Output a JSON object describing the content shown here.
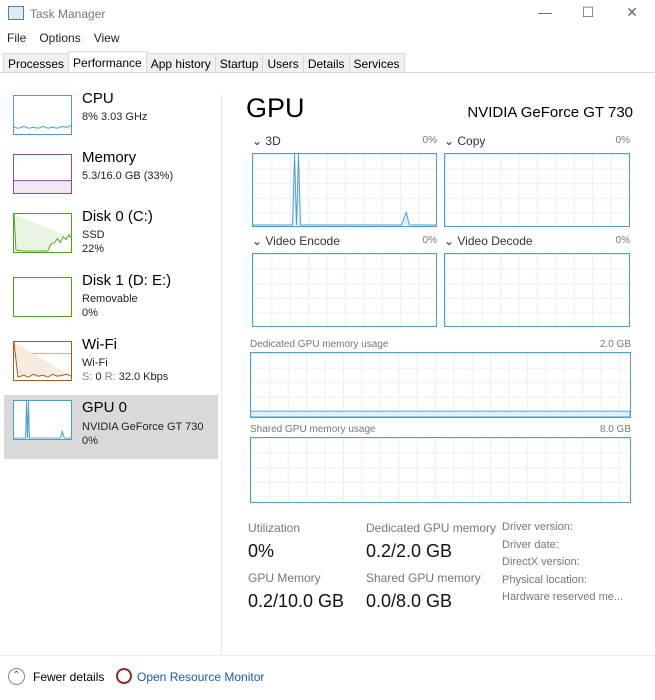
{
  "window": {
    "title": "Task Manager",
    "minimize": "—",
    "maximize": "☐",
    "close": "✕"
  },
  "menu": [
    "File",
    "Options",
    "View"
  ],
  "tabs": [
    "Processes",
    "Performance",
    "App history",
    "Startup",
    "Users",
    "Details",
    "Services"
  ],
  "sidebar": [
    {
      "name": "CPU",
      "line1": "8% 3.03 GHz",
      "line2": "",
      "color": "#4d9ecb"
    },
    {
      "name": "Memory",
      "line1": "5.3/16.0 GB (33%)",
      "line2": "",
      "color": "#8b4d9b"
    },
    {
      "name": "Disk 0 (C:)",
      "line1": "SSD",
      "line2": "22%",
      "color": "#4da01c"
    },
    {
      "name": "Disk 1 (D: E:)",
      "line1": "Removable",
      "line2": "0%",
      "color": "#4da01c"
    },
    {
      "name": "Wi-Fi",
      "line1": "Wi-Fi",
      "line2_s": "S:",
      "line2_sv": "0",
      "line2_r": "R:",
      "line2_rv": "32.0 Kbps",
      "color": "#a7591b"
    },
    {
      "name": "GPU 0",
      "line1": "NVIDIA GeForce GT 730",
      "line2": "0%",
      "color": "#4d9ecb"
    }
  ],
  "main": {
    "title": "GPU",
    "model": "NVIDIA GeForce GT 730",
    "engines": [
      {
        "label": "3D",
        "pct": "0%"
      },
      {
        "label": "Copy",
        "pct": "0%"
      },
      {
        "label": "Video Encode",
        "pct": "0%"
      },
      {
        "label": "Video Decode",
        "pct": "0%"
      }
    ],
    "dedicated": {
      "label": "Dedicated GPU memory usage",
      "max": "2.0 GB"
    },
    "shared": {
      "label": "Shared GPU memory usage",
      "max": "8.0 GB"
    },
    "stats": {
      "utilization_label": "Utilization",
      "utilization": "0%",
      "dedicated_label": "Dedicated GPU memory",
      "dedicated": "0.2/2.0 GB",
      "gpumem_label": "GPU Memory",
      "gpumem": "0.2/10.0 GB",
      "shared_label": "Shared GPU memory",
      "shared": "0.0/8.0 GB"
    },
    "driver": [
      "Driver version:",
      "Driver date:",
      "DirectX version:",
      "Physical location:",
      "Hardware reserved me..."
    ]
  },
  "footer": {
    "fewer": "Fewer details",
    "monitor": "Open Resource Monitor"
  }
}
